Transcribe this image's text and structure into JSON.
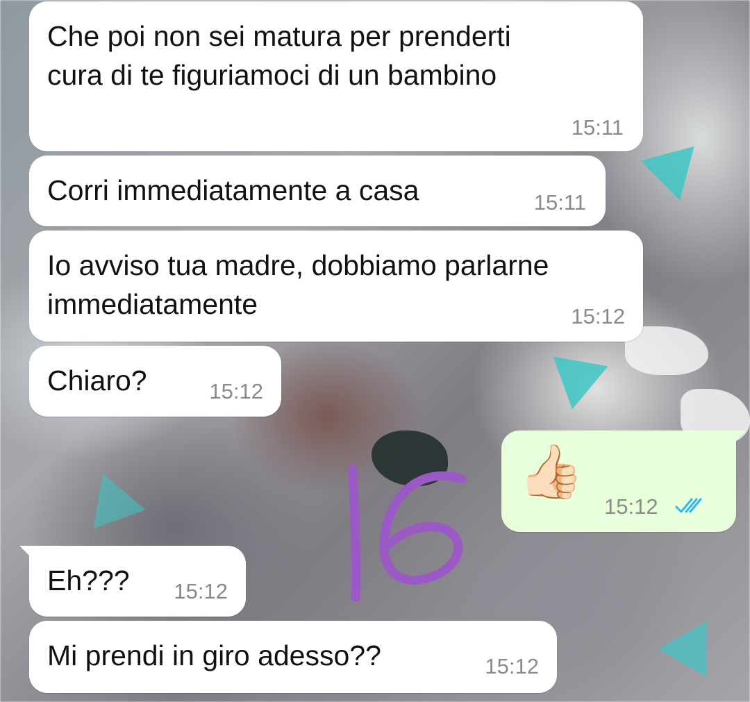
{
  "chat": {
    "messages": [
      {
        "direction": "in",
        "text_lines": [
          "Che poi non sei matura per prenderti",
          "cura di te figuriamoci di un bambino"
        ],
        "time": "15:11"
      },
      {
        "direction": "in",
        "text_lines": [
          "Corri immediatamente a casa"
        ],
        "time": "15:11"
      },
      {
        "direction": "in",
        "text_lines": [
          "Io avviso tua madre, dobbiamo parlarne",
          "immediatamente"
        ],
        "time": "15:12"
      },
      {
        "direction": "in",
        "text_lines": [
          "Chiaro?"
        ],
        "time": "15:12"
      },
      {
        "direction": "out",
        "emoji": "👍🏻",
        "emoji_name": "thumbs-up-light-skin",
        "time": "15:12",
        "status": "read",
        "status_icon": "double-check-icon",
        "status_color": "#34b7f1"
      },
      {
        "direction": "in",
        "text_lines": [
          "Eh???"
        ],
        "time": "15:12"
      },
      {
        "direction": "in",
        "text_lines": [
          "Mi prendi in giro adesso??"
        ],
        "time": "15:12"
      }
    ]
  },
  "annotation": {
    "text": "16",
    "color": "#9b59c6"
  },
  "colors": {
    "incoming_bubble": "#ffffff",
    "outgoing_bubble": "#e7ffdb",
    "timestamp": "#8a8a8a"
  }
}
